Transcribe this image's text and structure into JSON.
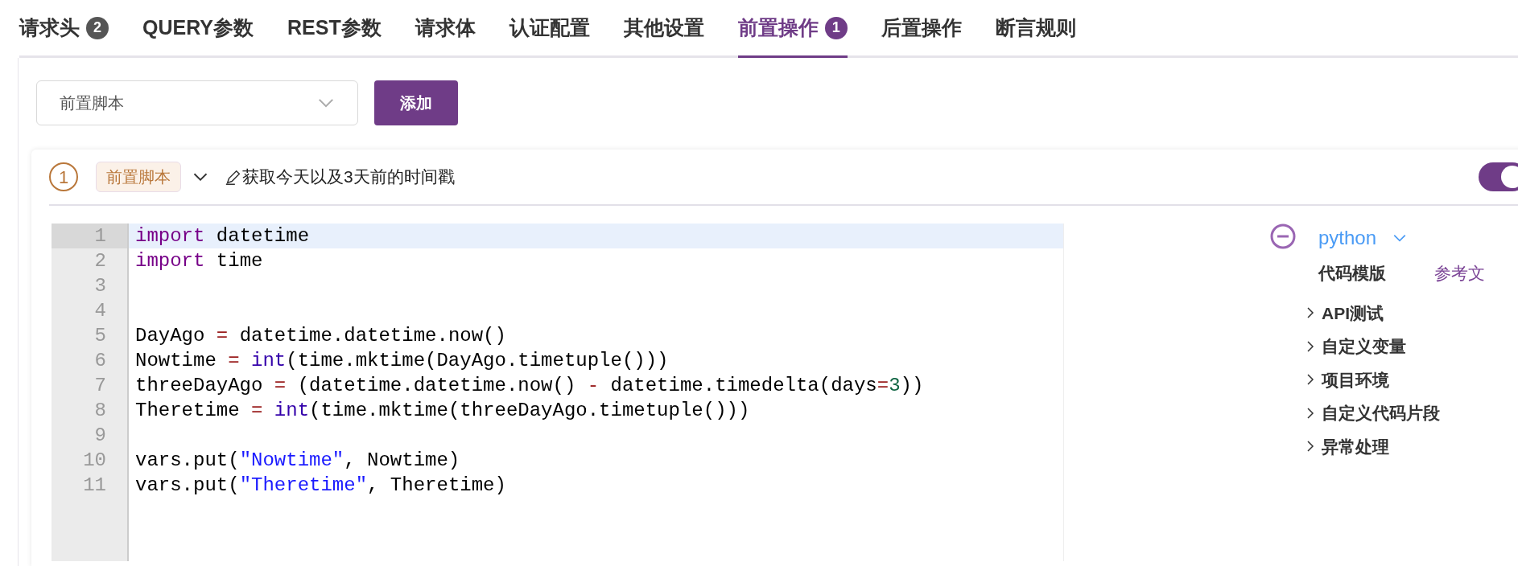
{
  "tabs": [
    {
      "label": "请求头",
      "badge": "2",
      "selected": false
    },
    {
      "label": "QUERY参数",
      "selected": false
    },
    {
      "label": "REST参数",
      "selected": false
    },
    {
      "label": "请求体",
      "selected": false
    },
    {
      "label": "认证配置",
      "selected": false
    },
    {
      "label": "其他设置",
      "selected": false
    },
    {
      "label": "前置操作",
      "badge": "1",
      "selected": true
    },
    {
      "label": "后置操作",
      "selected": false
    },
    {
      "label": "断言规则",
      "selected": false
    }
  ],
  "add_bar": {
    "select_value": "前置脚本",
    "button": "添加"
  },
  "step": {
    "index": "1",
    "tag": "前置脚本",
    "title": "获取今天以及3天前的时间戳",
    "enabled": true,
    "editor": {
      "lines": [
        {
          "number": "1",
          "selected": true,
          "tokens": [
            {
              "kind": "keyword",
              "text": "import"
            },
            {
              "kind": "plain",
              "text": " datetime"
            }
          ]
        },
        {
          "number": "2",
          "selected": false,
          "tokens": [
            {
              "kind": "keyword",
              "text": "import"
            },
            {
              "kind": "plain",
              "text": " time"
            }
          ]
        },
        {
          "number": "3",
          "selected": false
        },
        {
          "number": "4",
          "selected": false
        },
        {
          "number": "5",
          "selected": false,
          "tokens": [
            {
              "kind": "plain",
              "text": "DayAgo "
            },
            {
              "kind": "operator",
              "text": "="
            },
            {
              "kind": "plain",
              "text": " datetime.datetime.now()"
            }
          ]
        },
        {
          "number": "6",
          "selected": false,
          "tokens": [
            {
              "kind": "plain",
              "text": "Nowtime "
            },
            {
              "kind": "operator",
              "text": "="
            },
            {
              "kind": "builtin",
              "text": " int"
            },
            {
              "kind": "plain",
              "text": "(time.mktime(DayAgo.timetuple()))"
            }
          ]
        },
        {
          "number": "7",
          "selected": false,
          "tokens": [
            {
              "kind": "plain",
              "text": "threeDayAgo "
            },
            {
              "kind": "operator",
              "text": "="
            },
            {
              "kind": "plain",
              "text": " (datetime.datetime.now() "
            },
            {
              "kind": "operator",
              "text": "-"
            },
            {
              "kind": "plain",
              "text": " datetime.timedelta(days"
            },
            {
              "kind": "operator",
              "text": "="
            },
            {
              "kind": "number",
              "text": "3"
            },
            {
              "kind": "plain",
              "text": "))"
            }
          ]
        },
        {
          "number": "8",
          "selected": false,
          "tokens": [
            {
              "kind": "plain",
              "text": "Theretime "
            },
            {
              "kind": "operator",
              "text": "="
            },
            {
              "kind": "builtin",
              "text": " int"
            },
            {
              "kind": "plain",
              "text": "(time.mktime(threeDayAgo.timetuple()))"
            }
          ]
        },
        {
          "number": "9",
          "selected": false
        },
        {
          "number": "10",
          "selected": false,
          "tokens": [
            {
              "kind": "plain",
              "text": "vars.put("
            },
            {
              "kind": "string",
              "text": "\"Nowtime\""
            },
            {
              "kind": "plain",
              "text": ", Nowtime)"
            }
          ]
        },
        {
          "number": "11",
          "selected": false,
          "tokens": [
            {
              "kind": "plain",
              "text": "vars.put("
            },
            {
              "kind": "string",
              "text": "\"Theretime\""
            },
            {
              "kind": "plain",
              "text": ", Theretime)"
            }
          ]
        }
      ]
    },
    "side": {
      "language": "python",
      "templates_label": "代码模版",
      "docs_link": "参考文",
      "groups": [
        {
          "label": "API测试",
          "expanded": false
        },
        {
          "label": "自定义变量",
          "expanded": false
        },
        {
          "label": "项目环境",
          "expanded": false
        },
        {
          "label": "自定义代码片段",
          "expanded": false
        },
        {
          "label": "异常处理",
          "expanded": false
        }
      ]
    }
  }
}
